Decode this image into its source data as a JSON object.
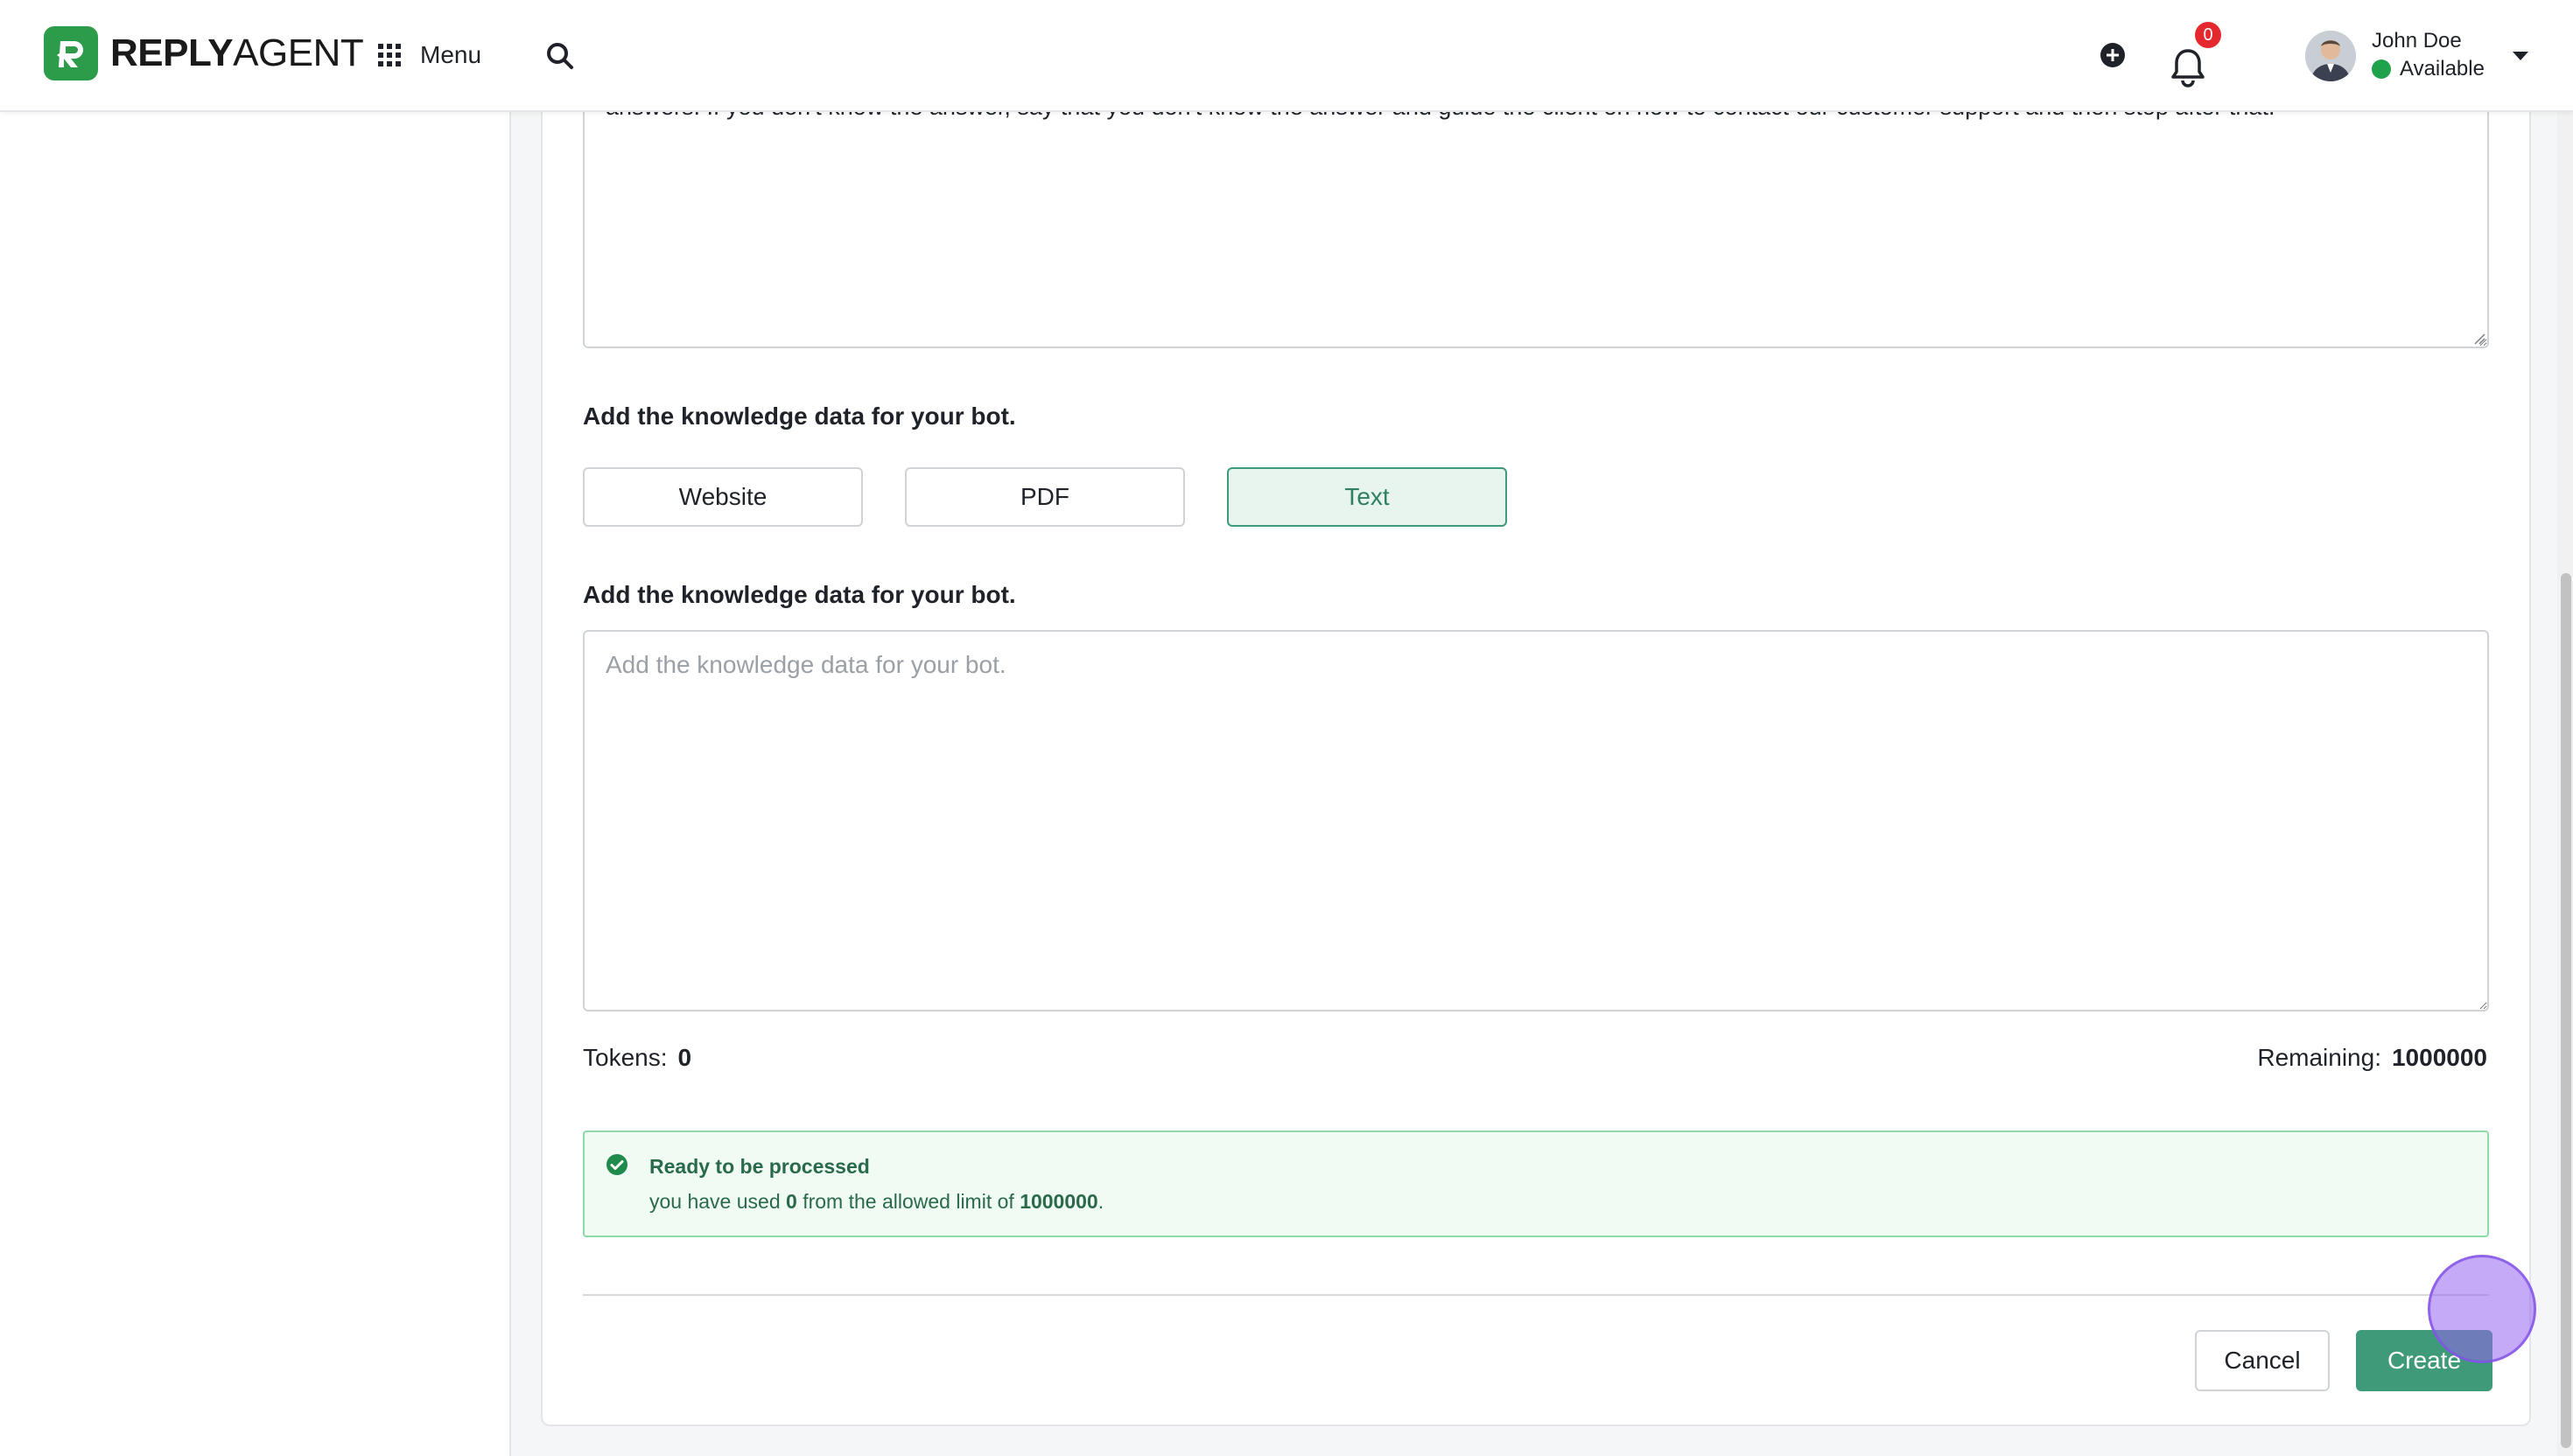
{
  "header": {
    "brand_bold": "REPLY",
    "brand_light": "AGENT",
    "menu_label": "Menu",
    "notification_count": "0",
    "user": {
      "name": "John Doe",
      "status": "Available"
    }
  },
  "form": {
    "prompt_text": "always structure the answer with different paragraphs.  RESTRICTIONS: Do NOT say Based on the given information. If you are not sure about the answer, do not make up answers. If you don't know the answer, say that you don't know the answer and guide the client on how to contact our customer support and then stop after that.",
    "source_label": "Add the knowledge data for your bot.",
    "sources": [
      {
        "label": "Website",
        "active": false
      },
      {
        "label": "PDF",
        "active": false
      },
      {
        "label": "Text",
        "active": true
      }
    ],
    "text_label": "Add the knowledge data for your bot.",
    "text_placeholder": "Add the knowledge data for your bot.",
    "text_value": "",
    "tokens_label": "Tokens:",
    "tokens_value": "0",
    "remaining_label": "Remaining:",
    "remaining_value": "1000000",
    "alert": {
      "title": "Ready to be processed",
      "body_prefix": "you have used",
      "used": "0",
      "body_middle": "from the allowed limit of",
      "limit": "1000000",
      "body_suffix": "."
    },
    "cancel_label": "Cancel",
    "create_label": "Create"
  },
  "colors": {
    "brand_green": "#2d9c4a",
    "primary": "#3e9a78",
    "badge_red": "#e5282e",
    "status_green": "#1ea34c",
    "alert_bg": "#effbf3"
  }
}
